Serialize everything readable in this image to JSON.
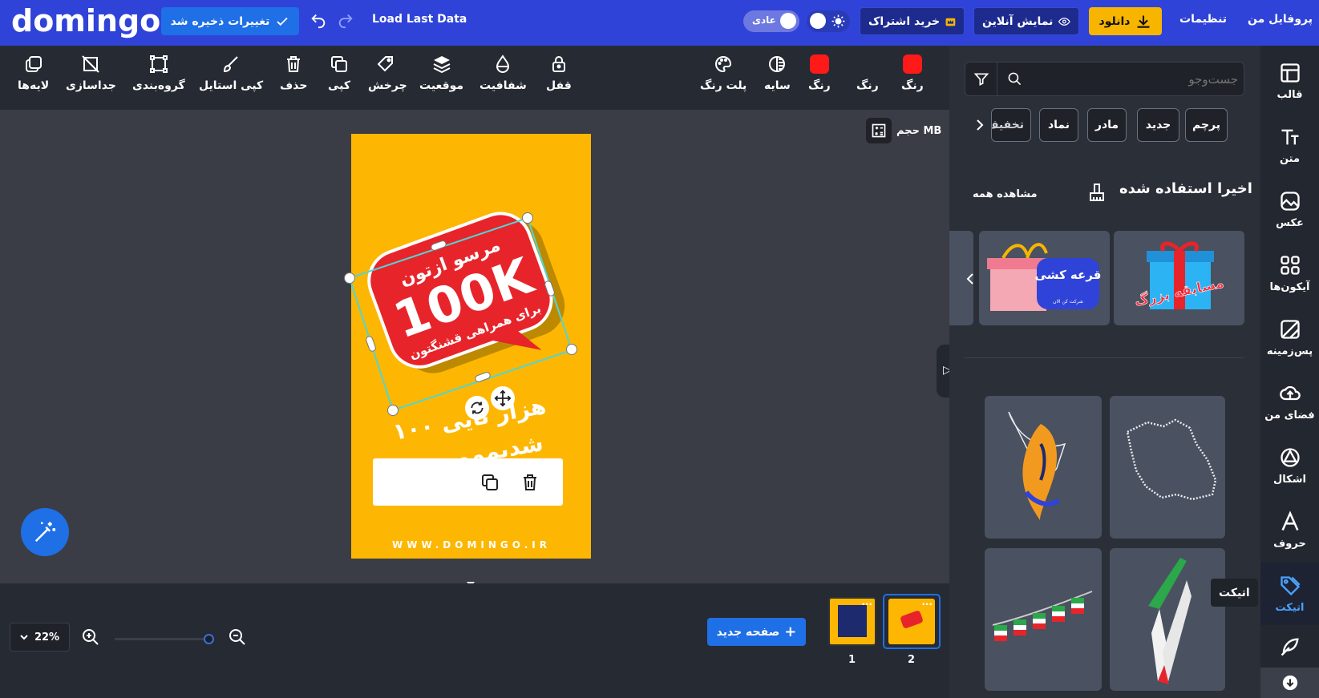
{
  "app": {
    "logo": "domingo"
  },
  "header": {
    "save_label": "تغییرات ذخیره شد",
    "load_last": "Load Last Data",
    "mode_label": "عادی",
    "buy_subscription": "خرید اشتراک",
    "online_preview": "نمایش آنلاین",
    "download": "دانلود",
    "settings": "تنظیمات",
    "profile": "پروفایل من"
  },
  "toolbar": {
    "tools": [
      {
        "label": "لایه‌ها",
        "icon": "layers-icon"
      },
      {
        "label": "جداسازی",
        "icon": "ungroup-icon"
      },
      {
        "label": "گروه‌بندی",
        "icon": "group-icon"
      },
      {
        "label": "کپی استایل",
        "icon": "brush-icon"
      },
      {
        "label": "حذف",
        "icon": "trash-icon"
      },
      {
        "label": "کپی",
        "icon": "copy-icon"
      },
      {
        "label": "چرخش",
        "icon": "rotate-icon"
      },
      {
        "label": "موقعیت",
        "icon": "stack-icon"
      },
      {
        "label": "شفافیت",
        "icon": "drop-icon"
      },
      {
        "label": "قفل",
        "icon": "lock-icon"
      }
    ],
    "palette_label": "پلت رنگ",
    "shadow_label": "سایه",
    "color1_label": "رنگ",
    "color2_label": "رنگ",
    "color3_label": "رنگ",
    "swatch_color": "#ff1a1a"
  },
  "canvas": {
    "size_label": "حجم MB",
    "badge_top": "مرسو ازتون",
    "badge_big": "100K",
    "badge_bottom": "برای همراهی قشنگتون",
    "body_line1": "۱۰۰ هزار تایی",
    "body_line2": "شدیمممممم",
    "website": "WWW.DOMINGO.IR",
    "bg_color": "#fdb702",
    "badge_color": "#e8242b"
  },
  "bottom": {
    "zoom": "22%",
    "new_page": "صفحه جدید",
    "pages": [
      {
        "number": "1"
      },
      {
        "number": "2"
      }
    ]
  },
  "panel": {
    "search_placeholder": "جست‌وجو",
    "chips": [
      "پرچم",
      "جدید",
      "مادر",
      "نماد",
      "تخفیف"
    ],
    "recent_title": "اخیرا استفاده شده",
    "see_all": "مشاهده همه",
    "recent_items": [
      {
        "title": "مسابقه بزرگ"
      },
      {
        "title": "قرعه کشی",
        "subtitle": "شرکت کن الان"
      }
    ]
  },
  "sidebar": {
    "items": [
      {
        "label": "قالب",
        "icon": "template-icon"
      },
      {
        "label": "متن",
        "icon": "text-icon"
      },
      {
        "label": "عکس",
        "icon": "photo-icon"
      },
      {
        "label": "آیکون‌ها",
        "icon": "grid-icon"
      },
      {
        "label": "پس‌زمینه",
        "icon": "background-icon"
      },
      {
        "label": "فضای من",
        "icon": "cloud-icon"
      },
      {
        "label": "اشکال",
        "icon": "shapes-icon"
      },
      {
        "label": "حروف",
        "icon": "letter-icon"
      },
      {
        "label": "اتیکت",
        "icon": "tag-icon"
      }
    ],
    "tooltip": "اتیکت"
  }
}
